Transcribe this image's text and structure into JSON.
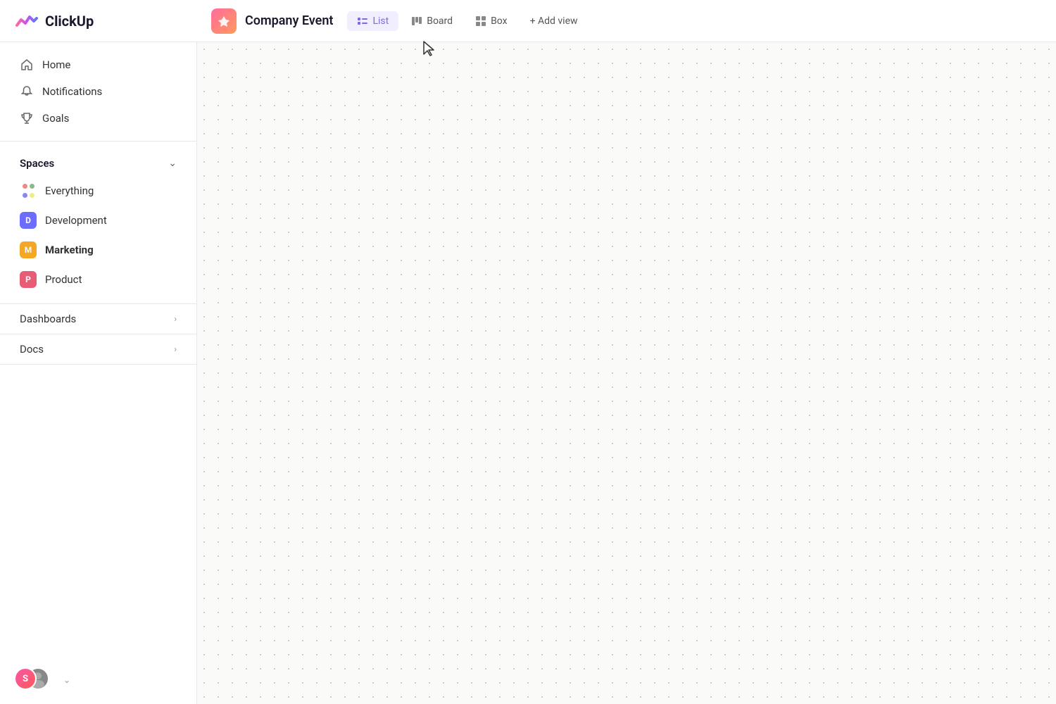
{
  "app": {
    "name": "ClickUp"
  },
  "header": {
    "project_name": "Company Event",
    "tabs": [
      {
        "id": "list",
        "label": "List",
        "icon": "list",
        "active": true
      },
      {
        "id": "board",
        "label": "Board",
        "icon": "board",
        "active": false
      },
      {
        "id": "box",
        "label": "Box",
        "icon": "box",
        "active": false
      }
    ],
    "add_view_label": "+ Add view"
  },
  "sidebar": {
    "nav_items": [
      {
        "id": "home",
        "label": "Home",
        "icon": "home"
      },
      {
        "id": "notifications",
        "label": "Notifications",
        "icon": "bell"
      },
      {
        "id": "goals",
        "label": "Goals",
        "icon": "trophy"
      }
    ],
    "spaces_title": "Spaces",
    "spaces": [
      {
        "id": "everything",
        "label": "Everything",
        "type": "dots"
      },
      {
        "id": "development",
        "label": "Development",
        "type": "avatar",
        "color": "#6c6cff",
        "letter": "D"
      },
      {
        "id": "marketing",
        "label": "Marketing",
        "type": "avatar",
        "color": "#f5a623",
        "letter": "M",
        "bold": true
      },
      {
        "id": "product",
        "label": "Product",
        "type": "avatar",
        "color": "#e85d75",
        "letter": "P"
      }
    ],
    "collapsibles": [
      {
        "id": "dashboards",
        "label": "Dashboards"
      },
      {
        "id": "docs",
        "label": "Docs"
      }
    ],
    "user_initial": "S"
  }
}
